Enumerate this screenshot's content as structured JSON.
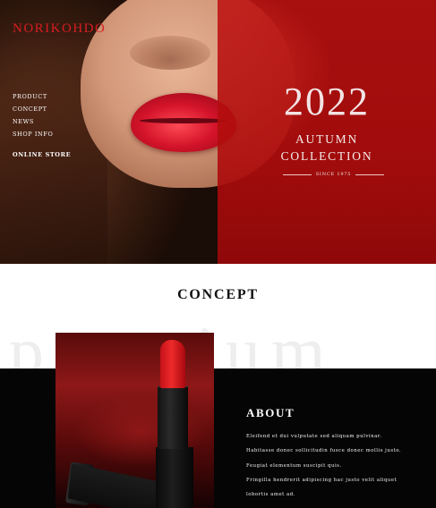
{
  "header": {
    "brand": "NORIKOHDO",
    "nav": [
      "PRODUCT",
      "CONCEPT",
      "NEWS",
      "SHOP INFO"
    ],
    "online_store": "ONLINE STORE"
  },
  "hero": {
    "year": "2022",
    "season_line1": "AUTUMN",
    "season_line2": "COLLECTION",
    "since": "SINCE 1975"
  },
  "concept": {
    "title": "CONCEPT",
    "watermark": "premium"
  },
  "about": {
    "title": "ABOUT",
    "lines": [
      "Eleifend et dui vulputate sed aliquam pulvinar.",
      "Habitasse donec sollicitudin fusce donec mollis justo.",
      "Feugiat elementum suscipit quis.",
      "Fringilla hendrerit adipiscing hac justo velit aliquet",
      "lobortis amet ad."
    ]
  },
  "colors": {
    "brand_red": "#d81c23",
    "panel_red": "#b80e10",
    "dark": "#050505"
  }
}
